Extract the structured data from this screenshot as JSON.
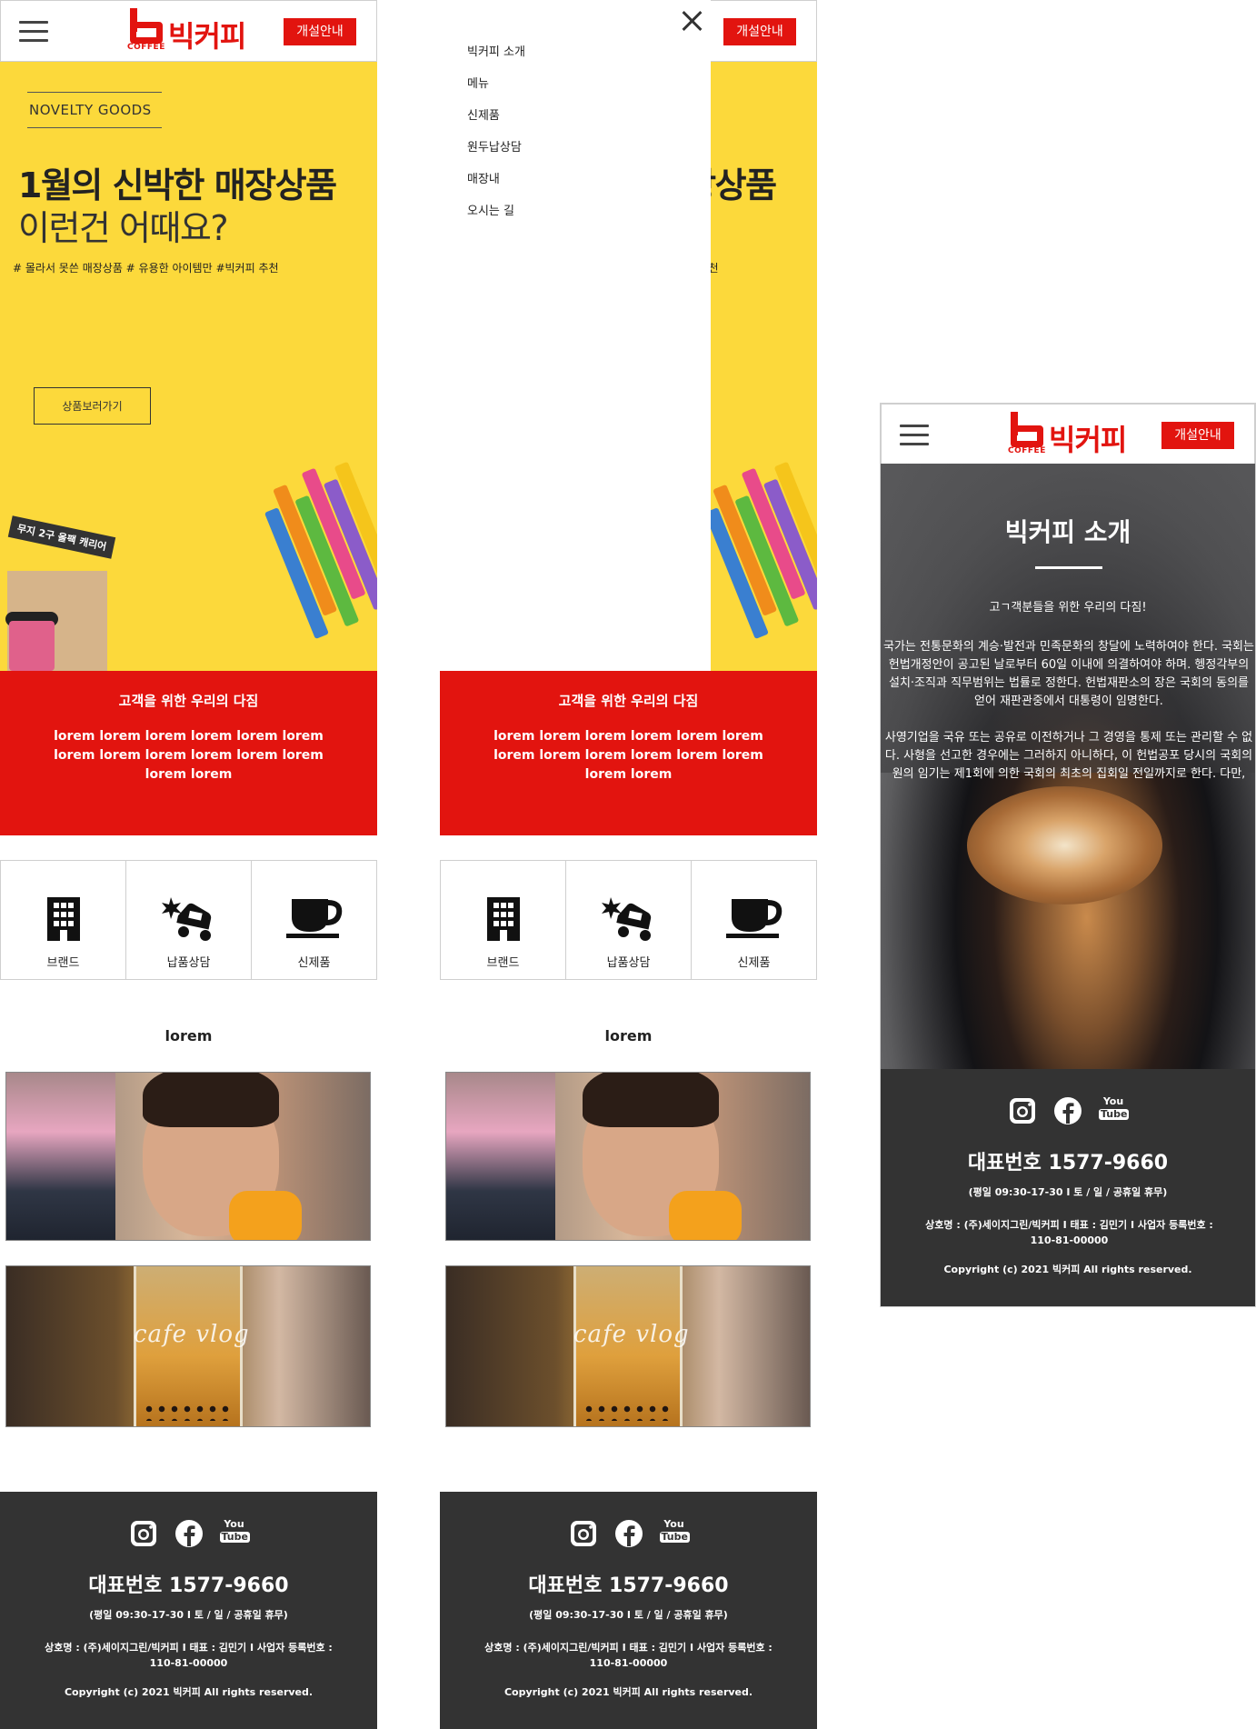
{
  "brand": {
    "name": "빅커피",
    "sub": "COFFEE",
    "open_label": "개설안내"
  },
  "hero": {
    "tag": "NOVELTY GOODS",
    "title1": "1월의 신박한 매장상품",
    "title2": "이런건 어때요?",
    "hashtags": "# 몰라서 못쓴 매장상품 # 유용한 아이템만 #빅커피 추천",
    "cta": "상품보러가기",
    "carrier_label": "무지 2구 올팩 캐리어"
  },
  "pledge": {
    "title": "고객을 위한 우리의 다짐",
    "body": "lorem lorem lorem lorem lorem lorem lorem lorem lorem lorem lorem lorem lorem lorem"
  },
  "quick_links": [
    {
      "label": "브랜드",
      "icon": "building-icon"
    },
    {
      "label": "납품상담",
      "icon": "car-crash-icon"
    },
    {
      "label": "신제품",
      "icon": "coffee-cup-icon"
    }
  ],
  "video_section": {
    "title": "lorem",
    "video2_caption": "cafe vlog"
  },
  "menu": {
    "items": [
      "빅커피 소개",
      "메뉴",
      "신제품",
      "원두납상담",
      "매장내",
      "오시는 길"
    ]
  },
  "intro": {
    "title": "빅커피 소개",
    "subtitle": "고ㄱ객분들을 위한 우리의 다짐!",
    "para1": "국가는 전통문화의 계승·발전과 민족문화의 창달에 노력하여야 한다. 국회는 헌법개정안이 공고된 날로부터 60일 이내에 의결하여야 하며. 헹정각부의 설치·조직과 직무범위는 법률로 정한다. 헌법재판소의 장은 국회의 동의를 얻어 재판관중에서 대통령이 임명한다.",
    "para2": "사영기업을 국유 또는 공유로 이전하거나 그 경영을 통제 또는 관리할 수 없다. 사형을 선고한 경우에는 그러하지 아니하다, 이 헌법공포 당시의 국회의원의 임기는 제1회에 의한 국회의 최초의 집회일 전일까지로 한다. 다만,"
  },
  "footer": {
    "social": [
      "instagram-icon",
      "facebook-icon",
      "youtube-icon"
    ],
    "youtube_top": "You",
    "youtube_bottom": "Tube",
    "phone": "대표번호 1577-9660",
    "hours": "(평일 09:30-17-30 I 토 / 일 / 공휴일 휴무)",
    "biz": "상호명 : (주)세이지그린/빅커피 I 태표 : 김민기 I 사업자 등록번호 : 110-81-00000",
    "copyright": "Copyright (c) 2021 빅커피 All rights reserved."
  },
  "colors": {
    "accent": "#e2140f",
    "hero_bg": "#fcd93b",
    "footer_bg": "#333333"
  }
}
